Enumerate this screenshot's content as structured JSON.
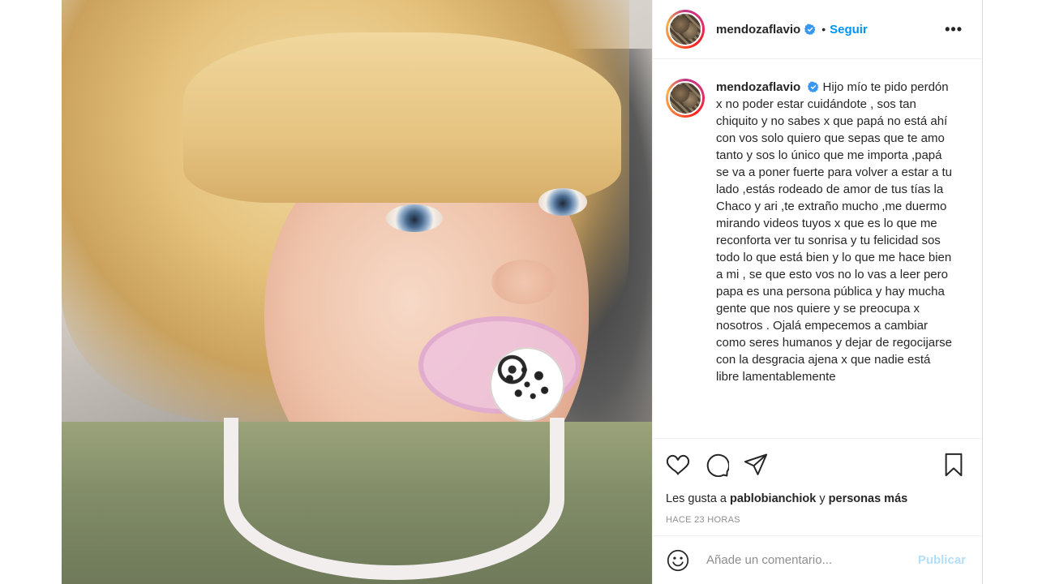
{
  "header": {
    "username": "mendozaflavio",
    "separator": "•",
    "follow_label": "Seguir",
    "more_label": "•••"
  },
  "caption": {
    "username": "mendozaflavio",
    "text": "Hijo mío te pido perdón x no poder estar cuidándote , sos tan chiquito y no sabes x que papá no está ahí con vos solo quiero que sepas que te amo tanto y sos lo único que me importa ,papá se va a poner fuerte para volver a estar a tu lado ,estás rodeado de amor de tus tías la Chaco y ari ,te extraño mucho ,me duermo mirando videos tuyos x que es lo que me reconforta ver tu sonrisa y tu felicidad sos todo lo que está bien y lo que me hace bien a mi , se que esto vos no lo vas a leer pero papa es una persona pública y hay mucha gente que nos quiere y se preocupa x nosotros . Ojalá empecemos a cambiar como seres humanos y dejar de regocijarse con la desgracia ajena x que nadie está libre lamentablemente"
  },
  "likes": {
    "prefix": "Les gusta a",
    "user": "pablobianchiok",
    "connector": "y",
    "suffix": "personas más"
  },
  "timestamp": "HACE 23 HORAS",
  "comment": {
    "placeholder": "Añade un comentario...",
    "publish_label": "Publicar"
  },
  "icons": {
    "like": "heart-icon",
    "comment": "comment-icon",
    "share": "send-icon",
    "save": "bookmark-icon",
    "emoji": "emoji-icon",
    "verified": "verified-badge-icon"
  },
  "colors": {
    "accent": "#0095f6",
    "publish_disabled": "#b2dffc",
    "verified": "#3897f0"
  }
}
